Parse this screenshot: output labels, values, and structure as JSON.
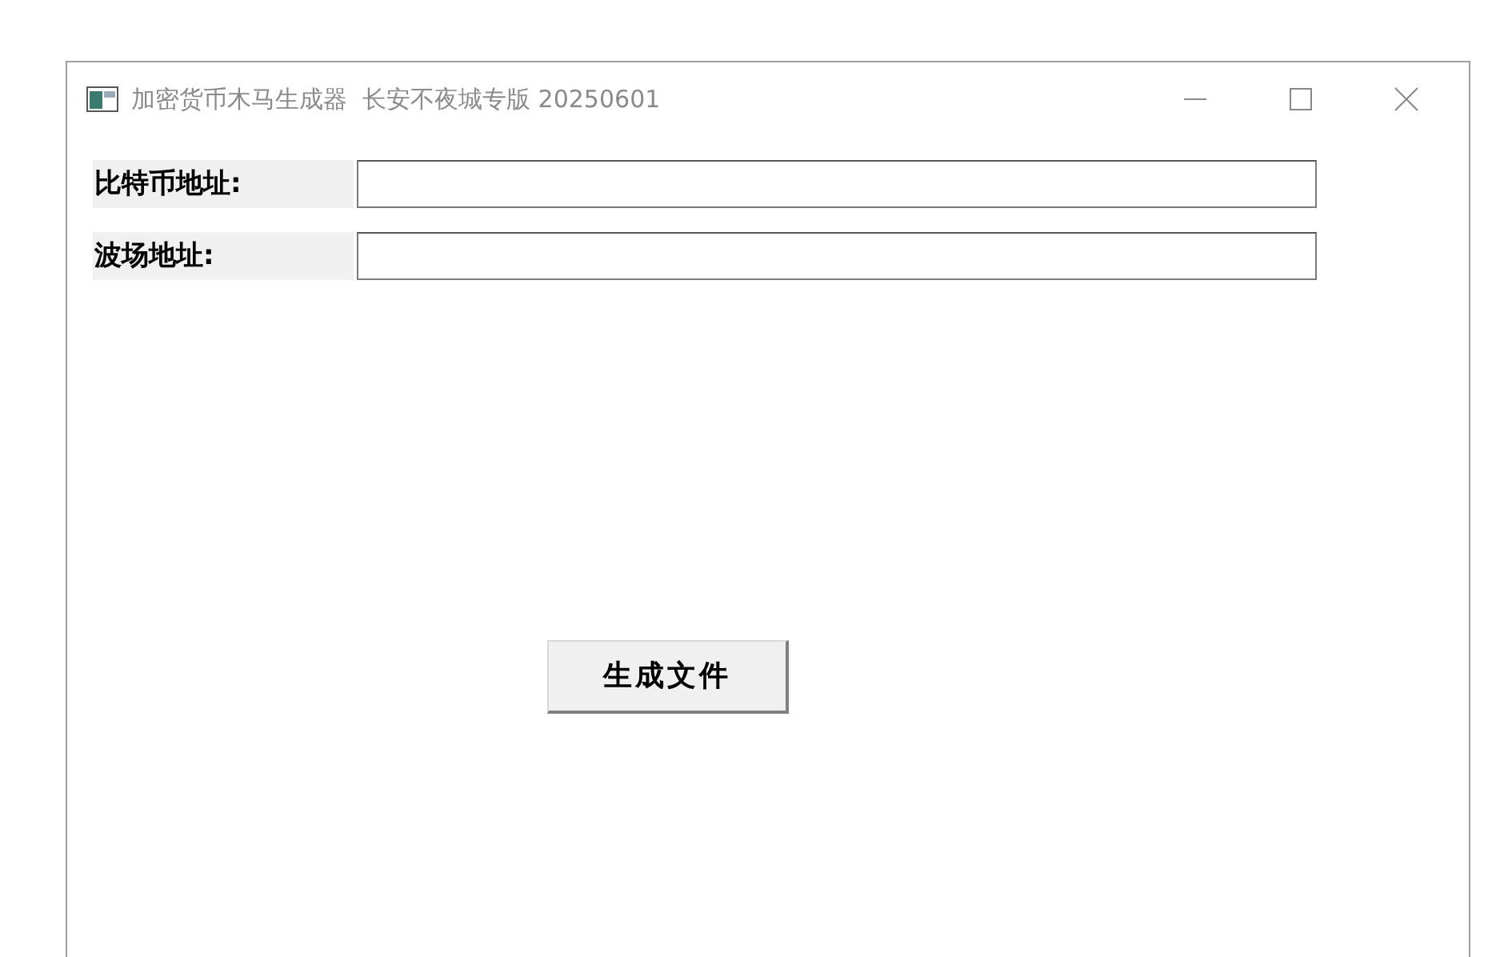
{
  "window": {
    "title": "加密货币木马生成器  长安不夜城专版 20250601"
  },
  "fields": [
    {
      "label": "比特币地址:"
    },
    {
      "label": "波场地址:"
    }
  ],
  "buttons": [
    "生成文件"
  ]
}
